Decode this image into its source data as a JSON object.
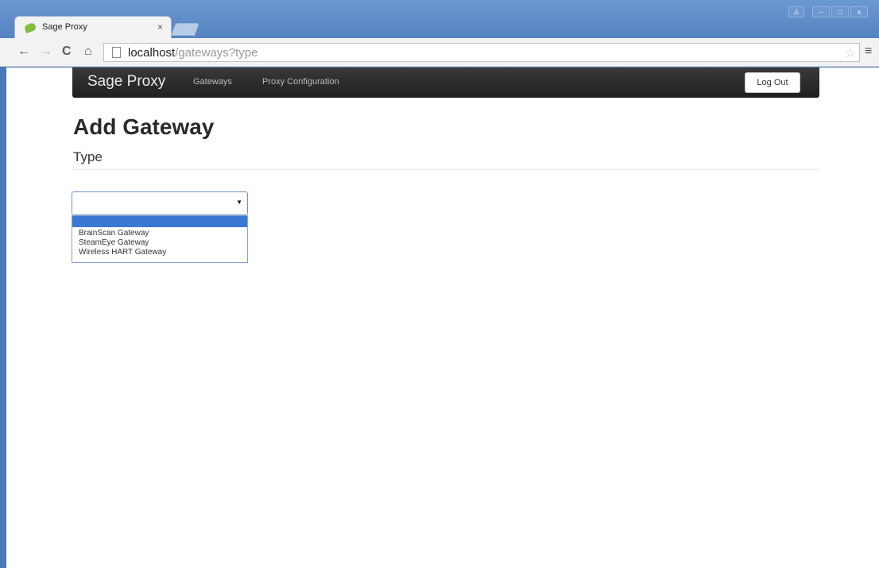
{
  "browser": {
    "tab_title": "Sage Proxy",
    "tab_close": "×",
    "url_host": "localhost",
    "url_path": "/gateways?type",
    "controls": {
      "back": "←",
      "forward": "→",
      "reload": "C",
      "home": "⌂",
      "star": "☆",
      "menu": "≡"
    },
    "window_buttons": {
      "user": "♙",
      "minimize": "–",
      "maximize": "□",
      "close": "x"
    }
  },
  "navbar": {
    "brand": "Sage Proxy",
    "links": [
      "Gateways",
      "Proxy Configuration"
    ],
    "logout_label": "Log Out"
  },
  "page": {
    "title": "Add Gateway",
    "subtitle": "Type"
  },
  "type_select": {
    "selected_value": "",
    "options": [
      "",
      "BrainScan Gateway",
      "SteamEye Gateway",
      "Wireless HART Gateway"
    ]
  },
  "colors": {
    "navbar_bg": "#222222",
    "highlight": "#3b78d4",
    "window_frame": "#4a7ab8"
  },
  "icons": {
    "favicon": "leaf-icon",
    "page": "page-icon",
    "dropdown": "caret-down-icon"
  }
}
